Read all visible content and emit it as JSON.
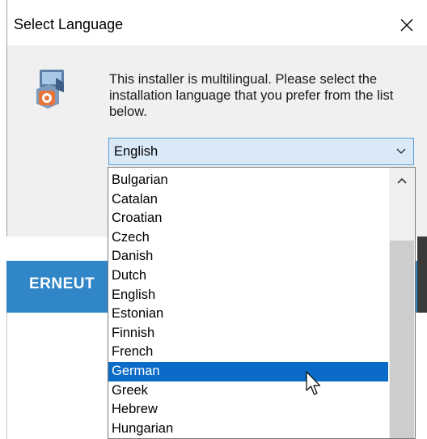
{
  "background": {
    "banner_text": "ERNEUT"
  },
  "dialog": {
    "title": "Select Language",
    "message": "This installer is multilingual. Please select the installation language that you prefer from the list below.",
    "selected_value": "English"
  },
  "dropdown": {
    "items": [
      "Bulgarian",
      "Catalan",
      "Croatian",
      "Czech",
      "Danish",
      "Dutch",
      "English",
      "Estonian",
      "Finnish",
      "French",
      "German",
      "Greek",
      "Hebrew",
      "Hungarian"
    ],
    "highlighted": "German"
  },
  "colors": {
    "banner": "#3186c7",
    "highlight": "#0a6cc8",
    "combo_bg": "#d9e9f8"
  },
  "icons": [
    "close-icon",
    "installer-icon",
    "chevron-down-icon",
    "chevron-up-icon",
    "mouse-cursor-icon"
  ]
}
